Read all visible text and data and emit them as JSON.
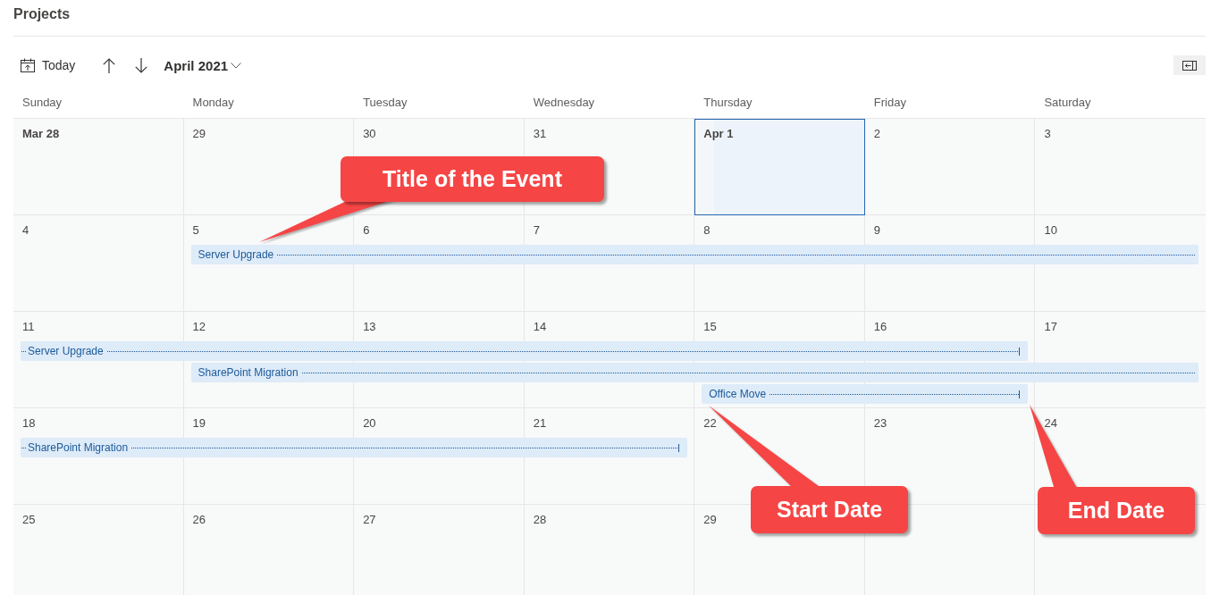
{
  "page": {
    "title": "Projects"
  },
  "toolbar": {
    "today_button": "Today",
    "month": "April 2021"
  },
  "calendar": {
    "weekdays": [
      "Sunday",
      "Monday",
      "Tuesday",
      "Wednesday",
      "Thursday",
      "Friday",
      "Saturday"
    ],
    "weeks": [
      {
        "days": [
          {
            "label": "Mar 28",
            "kind": "month_start",
            "selected": false
          },
          {
            "label": "29",
            "kind": "day",
            "selected": false
          },
          {
            "label": "30",
            "kind": "day",
            "selected": false
          },
          {
            "label": "31",
            "kind": "day",
            "selected": false
          },
          {
            "label": "Apr 1",
            "kind": "month_start",
            "selected": true
          },
          {
            "label": "2",
            "kind": "day",
            "selected": false
          },
          {
            "label": "3",
            "kind": "day",
            "selected": false
          }
        ]
      },
      {
        "days": [
          {
            "label": "4",
            "kind": "day",
            "selected": false
          },
          {
            "label": "5",
            "kind": "day",
            "selected": false
          },
          {
            "label": "6",
            "kind": "day",
            "selected": false
          },
          {
            "label": "7",
            "kind": "day",
            "selected": false
          },
          {
            "label": "8",
            "kind": "day",
            "selected": false
          },
          {
            "label": "9",
            "kind": "day",
            "selected": false
          },
          {
            "label": "10",
            "kind": "day",
            "selected": false
          }
        ],
        "events": [
          {
            "title": "Server Upgrade",
            "continues_before": false,
            "continues_after": true
          }
        ]
      },
      {
        "days": [
          {
            "label": "11",
            "kind": "day",
            "selected": false
          },
          {
            "label": "12",
            "kind": "day",
            "selected": false
          },
          {
            "label": "13",
            "kind": "day",
            "selected": false
          },
          {
            "label": "14",
            "kind": "day",
            "selected": false
          },
          {
            "label": "15",
            "kind": "day",
            "selected": false
          },
          {
            "label": "16",
            "kind": "day",
            "selected": false
          },
          {
            "label": "17",
            "kind": "day",
            "selected": false
          }
        ],
        "events": [
          {
            "title": "Server Upgrade",
            "continues_before": true,
            "continues_after": false
          },
          {
            "title": "SharePoint Migration",
            "continues_before": false,
            "continues_after": true
          },
          {
            "title": "Office Move",
            "continues_before": false,
            "continues_after": false
          }
        ]
      },
      {
        "days": [
          {
            "label": "18",
            "kind": "day",
            "selected": false
          },
          {
            "label": "19",
            "kind": "day",
            "selected": false
          },
          {
            "label": "20",
            "kind": "day",
            "selected": false
          },
          {
            "label": "21",
            "kind": "day",
            "selected": false
          },
          {
            "label": "22",
            "kind": "day",
            "selected": false
          },
          {
            "label": "23",
            "kind": "day",
            "selected": false
          },
          {
            "label": "24",
            "kind": "day",
            "selected": false
          }
        ],
        "events": [
          {
            "title": "SharePoint Migration",
            "continues_before": true,
            "continues_after": false
          }
        ]
      },
      {
        "days": [
          {
            "label": "25",
            "kind": "day",
            "selected": false
          },
          {
            "label": "26",
            "kind": "day",
            "selected": false
          },
          {
            "label": "27",
            "kind": "day",
            "selected": false
          },
          {
            "label": "28",
            "kind": "day",
            "selected": false
          },
          {
            "label": "29",
            "kind": "day",
            "selected": false
          }
        ]
      }
    ]
  },
  "annotations": [
    {
      "text": "Title of the Event"
    },
    {
      "text": "Start Date"
    },
    {
      "text": "End Date"
    }
  ]
}
